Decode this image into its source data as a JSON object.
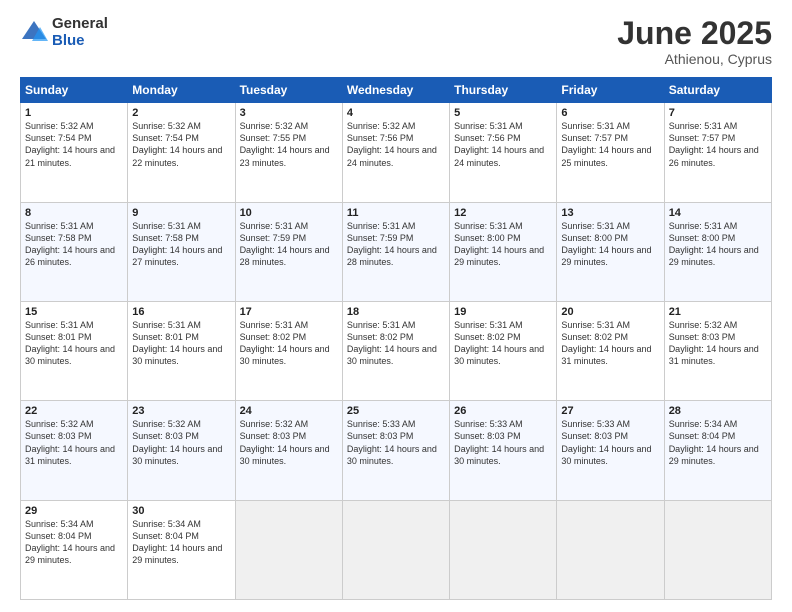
{
  "logo": {
    "general": "General",
    "blue": "Blue"
  },
  "title": {
    "month": "June 2025",
    "location": "Athienou, Cyprus"
  },
  "calendar": {
    "headers": [
      "Sunday",
      "Monday",
      "Tuesday",
      "Wednesday",
      "Thursday",
      "Friday",
      "Saturday"
    ],
    "rows": [
      [
        {
          "day": "1",
          "sunrise": "5:32 AM",
          "sunset": "7:54 PM",
          "daylight": "14 hours and 21 minutes."
        },
        {
          "day": "2",
          "sunrise": "5:32 AM",
          "sunset": "7:54 PM",
          "daylight": "14 hours and 22 minutes."
        },
        {
          "day": "3",
          "sunrise": "5:32 AM",
          "sunset": "7:55 PM",
          "daylight": "14 hours and 23 minutes."
        },
        {
          "day": "4",
          "sunrise": "5:32 AM",
          "sunset": "7:56 PM",
          "daylight": "14 hours and 24 minutes."
        },
        {
          "day": "5",
          "sunrise": "5:31 AM",
          "sunset": "7:56 PM",
          "daylight": "14 hours and 24 minutes."
        },
        {
          "day": "6",
          "sunrise": "5:31 AM",
          "sunset": "7:57 PM",
          "daylight": "14 hours and 25 minutes."
        },
        {
          "day": "7",
          "sunrise": "5:31 AM",
          "sunset": "7:57 PM",
          "daylight": "14 hours and 26 minutes."
        }
      ],
      [
        {
          "day": "8",
          "sunrise": "5:31 AM",
          "sunset": "7:58 PM",
          "daylight": "14 hours and 26 minutes."
        },
        {
          "day": "9",
          "sunrise": "5:31 AM",
          "sunset": "7:58 PM",
          "daylight": "14 hours and 27 minutes."
        },
        {
          "day": "10",
          "sunrise": "5:31 AM",
          "sunset": "7:59 PM",
          "daylight": "14 hours and 28 minutes."
        },
        {
          "day": "11",
          "sunrise": "5:31 AM",
          "sunset": "7:59 PM",
          "daylight": "14 hours and 28 minutes."
        },
        {
          "day": "12",
          "sunrise": "5:31 AM",
          "sunset": "8:00 PM",
          "daylight": "14 hours and 29 minutes."
        },
        {
          "day": "13",
          "sunrise": "5:31 AM",
          "sunset": "8:00 PM",
          "daylight": "14 hours and 29 minutes."
        },
        {
          "day": "14",
          "sunrise": "5:31 AM",
          "sunset": "8:00 PM",
          "daylight": "14 hours and 29 minutes."
        }
      ],
      [
        {
          "day": "15",
          "sunrise": "5:31 AM",
          "sunset": "8:01 PM",
          "daylight": "14 hours and 30 minutes."
        },
        {
          "day": "16",
          "sunrise": "5:31 AM",
          "sunset": "8:01 PM",
          "daylight": "14 hours and 30 minutes."
        },
        {
          "day": "17",
          "sunrise": "5:31 AM",
          "sunset": "8:02 PM",
          "daylight": "14 hours and 30 minutes."
        },
        {
          "day": "18",
          "sunrise": "5:31 AM",
          "sunset": "8:02 PM",
          "daylight": "14 hours and 30 minutes."
        },
        {
          "day": "19",
          "sunrise": "5:31 AM",
          "sunset": "8:02 PM",
          "daylight": "14 hours and 30 minutes."
        },
        {
          "day": "20",
          "sunrise": "5:31 AM",
          "sunset": "8:02 PM",
          "daylight": "14 hours and 31 minutes."
        },
        {
          "day": "21",
          "sunrise": "5:32 AM",
          "sunset": "8:03 PM",
          "daylight": "14 hours and 31 minutes."
        }
      ],
      [
        {
          "day": "22",
          "sunrise": "5:32 AM",
          "sunset": "8:03 PM",
          "daylight": "14 hours and 31 minutes."
        },
        {
          "day": "23",
          "sunrise": "5:32 AM",
          "sunset": "8:03 PM",
          "daylight": "14 hours and 30 minutes."
        },
        {
          "day": "24",
          "sunrise": "5:32 AM",
          "sunset": "8:03 PM",
          "daylight": "14 hours and 30 minutes."
        },
        {
          "day": "25",
          "sunrise": "5:33 AM",
          "sunset": "8:03 PM",
          "daylight": "14 hours and 30 minutes."
        },
        {
          "day": "26",
          "sunrise": "5:33 AM",
          "sunset": "8:03 PM",
          "daylight": "14 hours and 30 minutes."
        },
        {
          "day": "27",
          "sunrise": "5:33 AM",
          "sunset": "8:03 PM",
          "daylight": "14 hours and 30 minutes."
        },
        {
          "day": "28",
          "sunrise": "5:34 AM",
          "sunset": "8:04 PM",
          "daylight": "14 hours and 29 minutes."
        }
      ],
      [
        {
          "day": "29",
          "sunrise": "5:34 AM",
          "sunset": "8:04 PM",
          "daylight": "14 hours and 29 minutes."
        },
        {
          "day": "30",
          "sunrise": "5:34 AM",
          "sunset": "8:04 PM",
          "daylight": "14 hours and 29 minutes."
        },
        null,
        null,
        null,
        null,
        null
      ]
    ]
  }
}
